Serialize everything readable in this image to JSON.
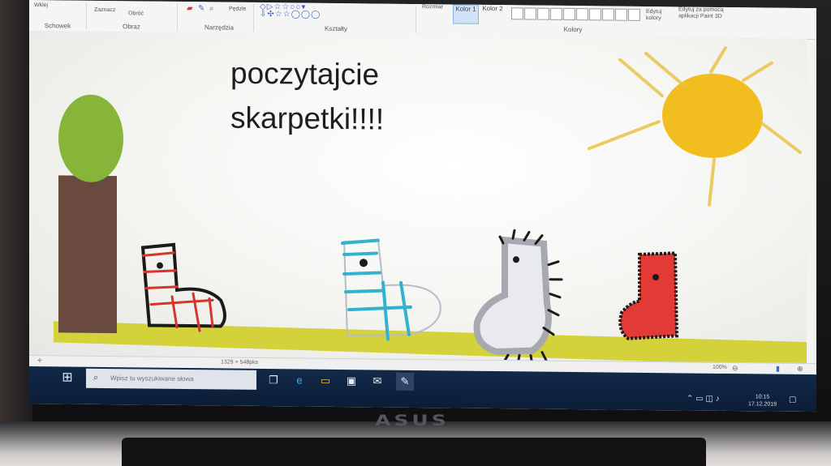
{
  "ribbon": {
    "groups": {
      "clipboard": "Schowek",
      "image": "Obraz",
      "tools": "Narzędzia",
      "shapes": "Kształty",
      "colors": "Kolory"
    },
    "paste_label": "Wklej",
    "select_label": "Zaznacz",
    "rotate_label": "Obróć",
    "brushes_label": "Pędzle",
    "size_label": "Rozmiar",
    "color1_label": "Kolor 1",
    "color2_label": "Kolor 2",
    "edit_colors_label": "Edytuj kolory",
    "paint3d_label": "Edytuj za pomocą aplikacji Paint 3D"
  },
  "canvas": {
    "text_line1": "poczytajcie",
    "text_line2": "skarpetki!!!!"
  },
  "statusbar": {
    "canvas_size": "1329 × 548pks",
    "zoom": "100%"
  },
  "taskbar": {
    "search_placeholder": "Wpisz tu wyszukiwane słowa",
    "time": "10:15",
    "date": "17.12.2019"
  },
  "laptop": {
    "brand": "ASUS"
  },
  "colors": {
    "ground": "#d4d23a",
    "sun": "#f2bd1f",
    "tree_crown": "#86b53a",
    "tree_trunk": "#6a4a3e",
    "red_sock": "#e33a36",
    "taskbar": "#0f2544"
  }
}
